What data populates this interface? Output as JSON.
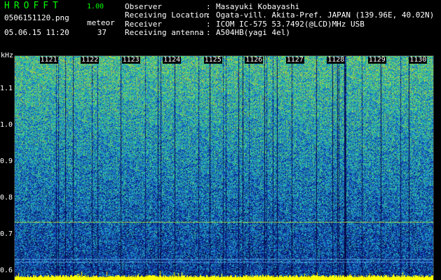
{
  "header": {
    "app_name": "HROFFT",
    "app_version": "1.00",
    "file_name": "0506151120.png",
    "datetime": "05.06.15 11:20",
    "meteor_label": "meteor",
    "meteor_count": "37"
  },
  "station": {
    "rows": [
      {
        "label": "Observer",
        "value": "Masayuki Kobayashi"
      },
      {
        "label": "Receiving Location",
        "value": "Ogata-vill. Akita-Pref. JAPAN (139.96E, 40.02N)"
      },
      {
        "label": "Receiver",
        "value": "ICOM IC-575 53.7492(@LCD)MHz USB"
      },
      {
        "label": "Receiving antenna",
        "value": "A504HB(yagi 4el)"
      }
    ]
  },
  "spectrogram": {
    "y_unit": "kHz",
    "y_ticks": [
      "1.1",
      "1.0",
      "0.9",
      "0.8",
      "0.7",
      "0.6"
    ],
    "y_tick_values": [
      1.1,
      1.0,
      0.9,
      0.8,
      0.7,
      0.6
    ],
    "y_range": [
      0.575,
      1.19
    ],
    "x_ticks": [
      "1121",
      "1122",
      "1123",
      "1124",
      "1125",
      "1126",
      "1127",
      "1128",
      "1129",
      "1130"
    ],
    "x_range_minutes": [
      1120,
      1130.2
    ],
    "carrier_line_khz": 0.735,
    "colors": {
      "background": "#000000",
      "text": "#ffffff",
      "title": "#00ff00",
      "noise_low": "#0a1a7a",
      "noise_mid": "#1a8ab0",
      "noise_high": "#ffff00",
      "baseline": "#ffff00"
    }
  }
}
